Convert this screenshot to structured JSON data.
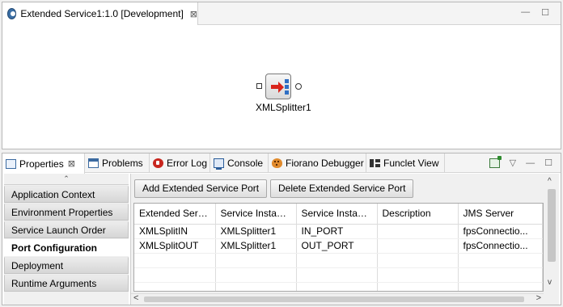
{
  "editor": {
    "tab_title": "Extended Service1:1.0 [Development]",
    "close_glyph": "⊠",
    "minimize_glyph": "—",
    "maximize_glyph": "☐",
    "component": {
      "label": "XMLSplitter1",
      "icon": "xml-splitter-icon"
    }
  },
  "views": {
    "tabs": [
      {
        "label": "Properties",
        "icon": "properties-icon",
        "active": true
      },
      {
        "label": "Problems",
        "icon": "problems-icon"
      },
      {
        "label": "Error Log",
        "icon": "error-log-icon"
      },
      {
        "label": "Console",
        "icon": "console-icon"
      },
      {
        "label": "Fiorano Debugger",
        "icon": "debugger-icon"
      },
      {
        "label": "Funclet View",
        "icon": "funclet-view-icon"
      }
    ],
    "close_glyph": "⊠",
    "menu_glyph": "▽",
    "minimize_glyph": "—",
    "maximize_glyph": "☐"
  },
  "sidebar": {
    "scroll_up_glyph": "⌃",
    "items": [
      {
        "label": "Application Context"
      },
      {
        "label": "Environment Properties"
      },
      {
        "label": "Service Launch Order"
      },
      {
        "label": "Port Configuration",
        "active": true
      },
      {
        "label": "Deployment"
      },
      {
        "label": "Runtime Arguments"
      }
    ]
  },
  "content": {
    "add_button": "Add Extended Service Port",
    "delete_button": "Delete Extended Service Port",
    "table": {
      "columns": [
        "Extended Servi...",
        "Service Instance",
        "Service Instanc...",
        "Description",
        "JMS Server"
      ],
      "rows": [
        [
          "XMLSplitIN",
          "XMLSplitter1",
          "IN_PORT",
          "",
          "fpsConnectio..."
        ],
        [
          "XMLSplitOUT",
          "XMLSplitter1",
          "OUT_PORT",
          "",
          "fpsConnectio..."
        ]
      ]
    }
  },
  "scroll": {
    "left_glyph": "<",
    "right_glyph": ">",
    "up_glyph": "^",
    "down_glyph": "v"
  }
}
